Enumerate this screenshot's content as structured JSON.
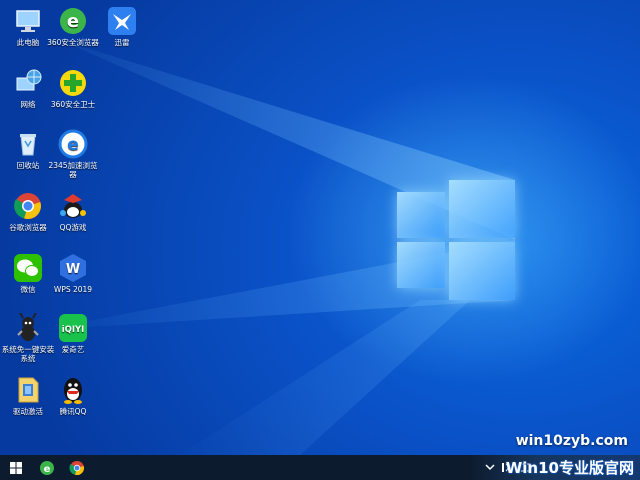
{
  "desktop": {
    "icons": [
      {
        "label": "此电脑",
        "icon": "computer-icon"
      },
      {
        "label": "360安全浏览器",
        "icon": "360-browser-icon"
      },
      {
        "label": "迅雷",
        "icon": "xunlei-icon"
      },
      {
        "label": "网络",
        "icon": "network-icon"
      },
      {
        "label": "360安全卫士",
        "icon": "360-security-icon"
      },
      {
        "label": "回收站",
        "icon": "recycle-bin-icon"
      },
      {
        "label": "2345加速浏览器",
        "icon": "2345-browser-icon"
      },
      {
        "label": "谷歌浏览器",
        "icon": "chrome-icon"
      },
      {
        "label": "QQ游戏",
        "icon": "qq-game-icon"
      },
      {
        "label": "微信",
        "icon": "wechat-icon"
      },
      {
        "label": "WPS 2019",
        "icon": "wps-icon"
      },
      {
        "label": "系统免一键安装系统",
        "icon": "system-install-icon"
      },
      {
        "label": "爱奇艺",
        "icon": "iqiyi-icon"
      },
      {
        "label": "驱动激活",
        "icon": "driver-activate-icon"
      },
      {
        "label": "腾讯QQ",
        "icon": "qq-icon"
      }
    ],
    "watermark": "win10zyb.com"
  },
  "taskbar": {
    "pinned": [
      "start-icon",
      "360-browser-icon",
      "chrome-icon"
    ],
    "brand": "Win10专业版官网"
  },
  "colors": {
    "desktop_blue": "#0a52c8",
    "taskbar_bg": "#0d1b2e"
  }
}
